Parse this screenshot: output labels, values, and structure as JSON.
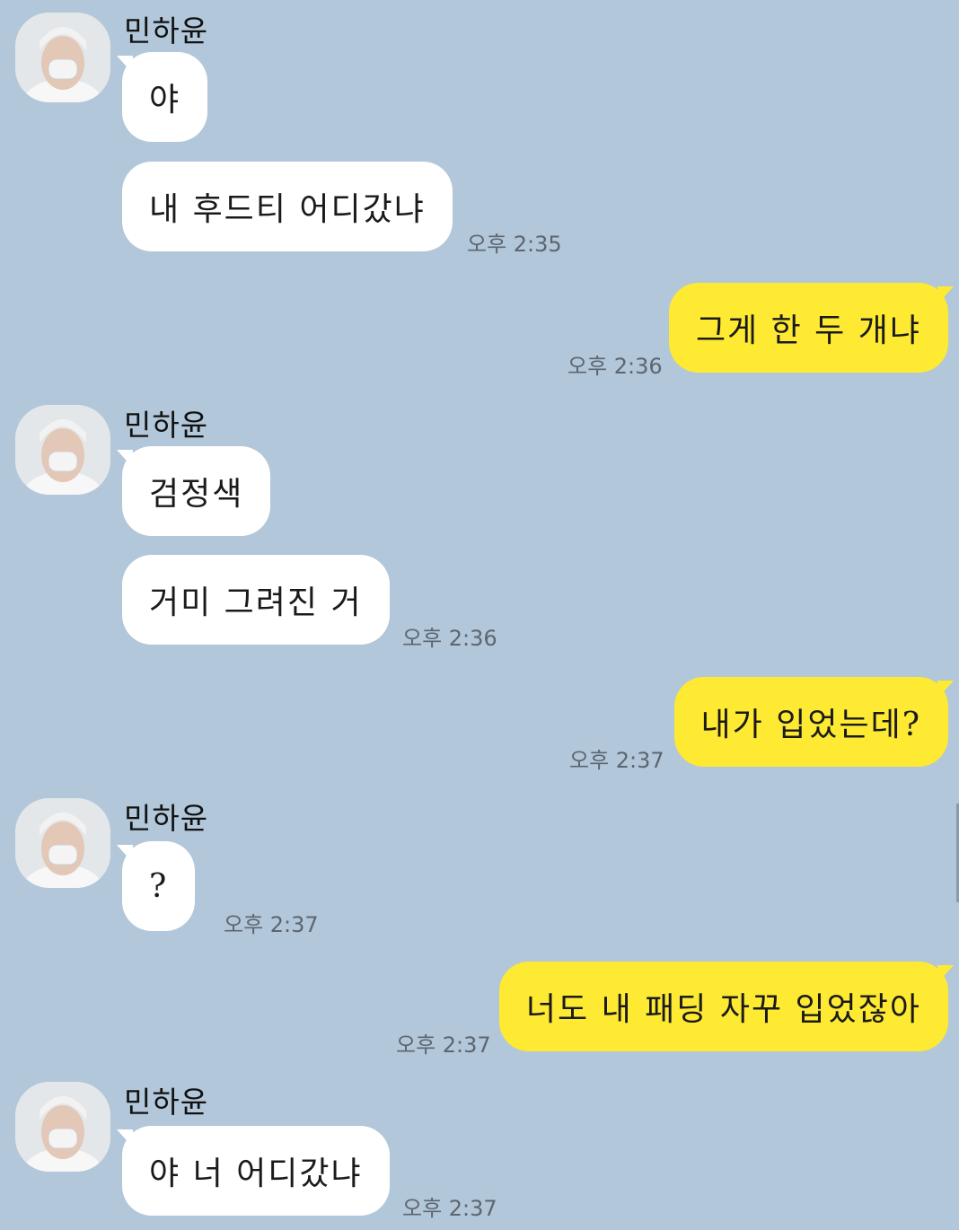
{
  "chat": {
    "sender_name": "민하윤",
    "groups": [
      {
        "type": "in",
        "messages": [
          "야",
          "내 후드티 어디갔냐"
        ],
        "time": "오후 2:35"
      },
      {
        "type": "out",
        "messages": [
          "그게 한 두 개냐"
        ],
        "time": "오후 2:36"
      },
      {
        "type": "in",
        "messages": [
          "검정색",
          "거미 그려진 거"
        ],
        "time": "오후 2:36"
      },
      {
        "type": "out",
        "messages": [
          "내가 입었는데?"
        ],
        "time": "오후 2:37"
      },
      {
        "type": "in",
        "messages": [
          "?"
        ],
        "time": "오후 2:37"
      },
      {
        "type": "out",
        "messages": [
          "너도 내 패딩 자꾸 입었잖아"
        ],
        "time": "오후 2:37"
      },
      {
        "type": "in",
        "messages": [
          "야 너 어디갔냐"
        ],
        "time": "오후 2:37"
      }
    ]
  },
  "colors": {
    "background": "#b2c7da",
    "incoming_bubble": "#ffffff",
    "outgoing_bubble": "#fee933"
  }
}
